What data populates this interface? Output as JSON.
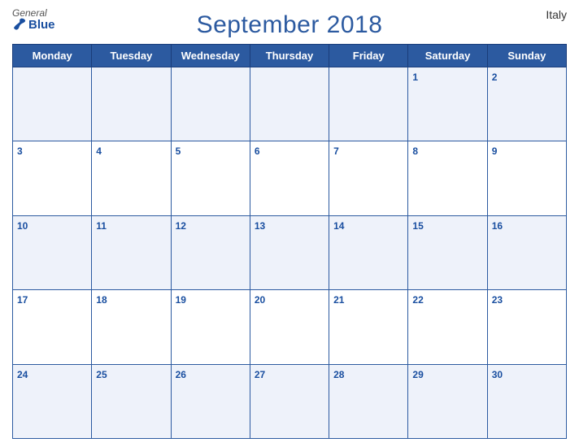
{
  "header": {
    "title": "September 2018",
    "country": "Italy",
    "logo_general": "General",
    "logo_blue": "Blue"
  },
  "days_of_week": [
    "Monday",
    "Tuesday",
    "Wednesday",
    "Thursday",
    "Friday",
    "Saturday",
    "Sunday"
  ],
  "weeks": [
    [
      {
        "date": "",
        "label": ""
      },
      {
        "date": "",
        "label": ""
      },
      {
        "date": "",
        "label": ""
      },
      {
        "date": "",
        "label": ""
      },
      {
        "date": "",
        "label": ""
      },
      {
        "date": "1",
        "label": "1"
      },
      {
        "date": "2",
        "label": "2"
      }
    ],
    [
      {
        "date": "3",
        "label": "3"
      },
      {
        "date": "4",
        "label": "4"
      },
      {
        "date": "5",
        "label": "5"
      },
      {
        "date": "6",
        "label": "6"
      },
      {
        "date": "7",
        "label": "7"
      },
      {
        "date": "8",
        "label": "8"
      },
      {
        "date": "9",
        "label": "9"
      }
    ],
    [
      {
        "date": "10",
        "label": "10"
      },
      {
        "date": "11",
        "label": "11"
      },
      {
        "date": "12",
        "label": "12"
      },
      {
        "date": "13",
        "label": "13"
      },
      {
        "date": "14",
        "label": "14"
      },
      {
        "date": "15",
        "label": "15"
      },
      {
        "date": "16",
        "label": "16"
      }
    ],
    [
      {
        "date": "17",
        "label": "17"
      },
      {
        "date": "18",
        "label": "18"
      },
      {
        "date": "19",
        "label": "19"
      },
      {
        "date": "20",
        "label": "20"
      },
      {
        "date": "21",
        "label": "21"
      },
      {
        "date": "22",
        "label": "22"
      },
      {
        "date": "23",
        "label": "23"
      }
    ],
    [
      {
        "date": "24",
        "label": "24"
      },
      {
        "date": "25",
        "label": "25"
      },
      {
        "date": "26",
        "label": "26"
      },
      {
        "date": "27",
        "label": "27"
      },
      {
        "date": "28",
        "label": "28"
      },
      {
        "date": "29",
        "label": "29"
      },
      {
        "date": "30",
        "label": "30"
      }
    ]
  ],
  "colors": {
    "header_bg": "#2c5aa0",
    "header_text": "#ffffff",
    "title_color": "#2c5aa0",
    "odd_row_bg": "#eef2fa",
    "even_row_bg": "#ffffff",
    "border": "#2c5aa0",
    "day_number": "#1a4fa0"
  }
}
